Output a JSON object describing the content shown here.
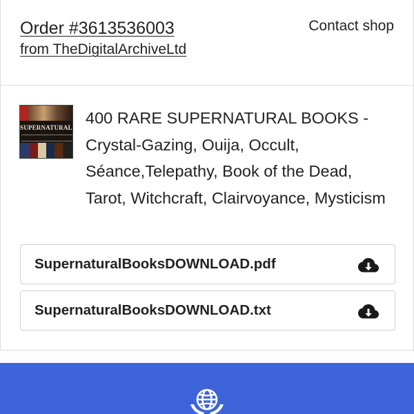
{
  "order": {
    "title": "Order #3613536003",
    "shop": "from TheDigitalArchiveLtd",
    "contact": "Contact shop"
  },
  "product": {
    "title": "400 RARE SUPERNATURAL BOOKS - Crystal-Gazing, Ouija, Occult, Séance,Telepathy, Book of the Dead, Tarot, Witchcraft, Clairvoyance, Mysticism",
    "thumbnail_text": "SUPERNATURAL"
  },
  "files": [
    {
      "name": "SupernaturalBooksDOWNLOAD.pdf",
      "icon": "cloud-download-icon"
    },
    {
      "name": "SupernaturalBooksDOWNLOAD.txt",
      "icon": "cloud-download-icon"
    }
  ],
  "footer": {
    "color": "#3d64d8",
    "icon": "globe-hands-icon"
  }
}
